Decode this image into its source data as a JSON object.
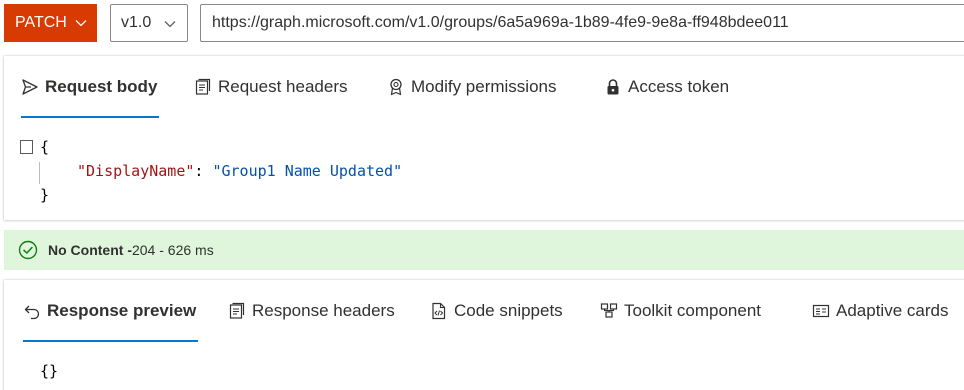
{
  "topbar": {
    "method": "PATCH",
    "version": "v1.0",
    "url": "https://graph.microsoft.com/v1.0/groups/6a5a969a-1b89-4fe9-9e8a-ff948bdee011"
  },
  "request": {
    "tabs": [
      {
        "label": "Request body",
        "icon": "send-icon",
        "active": true
      },
      {
        "label": "Request headers",
        "icon": "document-icon",
        "active": false
      },
      {
        "label": "Modify permissions",
        "icon": "certificate-icon",
        "active": false
      },
      {
        "label": "Access token",
        "icon": "lock-icon",
        "active": false
      }
    ],
    "body": {
      "open_brace": "{",
      "key": "\"DisplayName\"",
      "colon": ": ",
      "value": "\"Group1 Name Updated\"",
      "close_brace": "}"
    }
  },
  "status": {
    "title": "No Content -",
    "detail": " 204 - 626 ms",
    "color": "#dff6dd",
    "icon": "check-circle-icon"
  },
  "response": {
    "tabs": [
      {
        "label": "Response preview",
        "icon": "undo-arrow-icon",
        "active": true
      },
      {
        "label": "Response headers",
        "icon": "document-icon",
        "active": false
      },
      {
        "label": "Code snippets",
        "icon": "code-file-icon",
        "active": false
      },
      {
        "label": "Toolkit component",
        "icon": "toolkit-icon",
        "active": false
      },
      {
        "label": "Adaptive cards",
        "icon": "card-icon",
        "active": false
      }
    ],
    "body": "{}"
  },
  "colors": {
    "accent": "#0078d4",
    "method_bg": "#d83b01"
  }
}
